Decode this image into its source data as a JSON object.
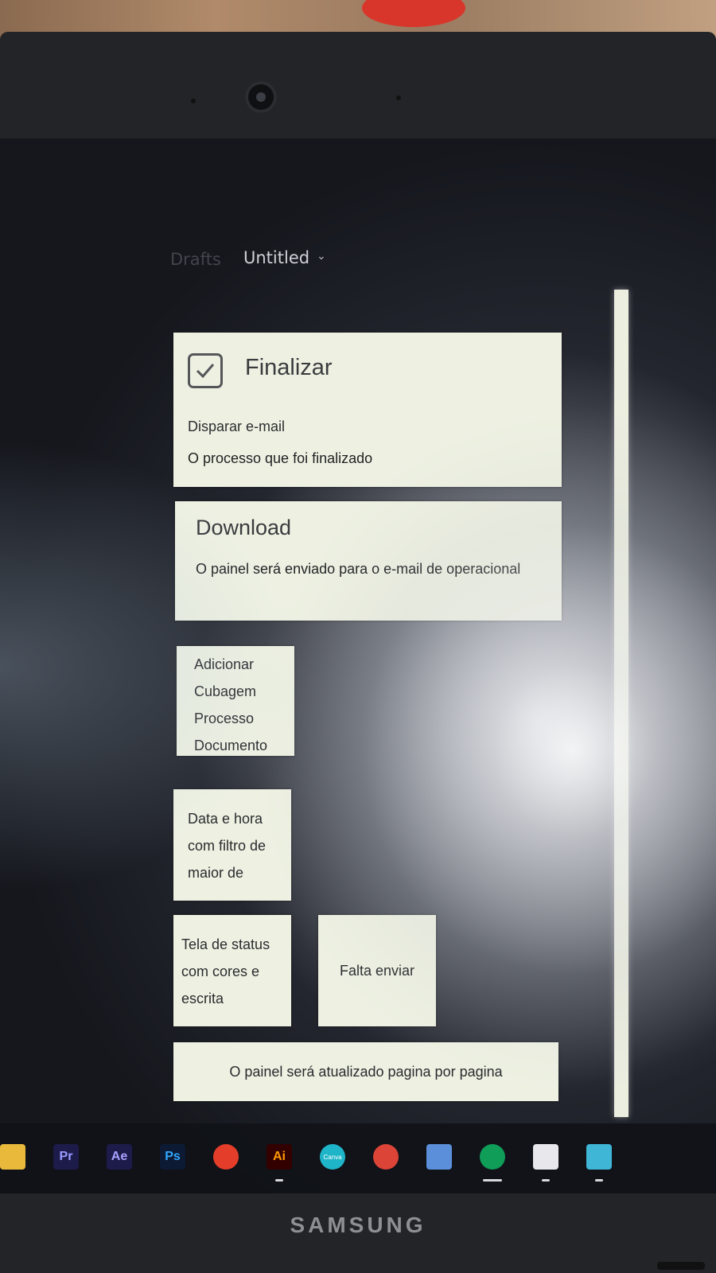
{
  "tabs": {
    "drafts": "Drafts",
    "current": "Untitled"
  },
  "cards": {
    "finalizar": {
      "title": "Finalizar",
      "line1": "Disparar e-mail",
      "line2": "O processo que foi finalizado"
    },
    "download": {
      "title": "Download",
      "body": "O painel será enviado para o e-mail de operacional"
    },
    "adicionar": [
      "Adicionar",
      "Cubagem",
      "Processo",
      "Documento"
    ],
    "data_hora": [
      "Data e hora",
      "com filtro de",
      "maior de"
    ],
    "tela_status": [
      "Tela de status",
      "com cores e",
      "escrita"
    ],
    "falta_enviar": "Falta enviar",
    "painel_atualizado": "O painel será atualizado pagina por pagina"
  },
  "taskbar": {
    "icons": [
      {
        "name": "folder-icon",
        "label": "",
        "bg": "#e8b93a",
        "fg": "#ffffff"
      },
      {
        "name": "premiere-icon",
        "label": "Pr",
        "bg": "#1d1b4a",
        "fg": "#9a9bff"
      },
      {
        "name": "after-effects-icon",
        "label": "Ae",
        "bg": "#1d1b4a",
        "fg": "#a9a2ff"
      },
      {
        "name": "photoshop-icon",
        "label": "Ps",
        "bg": "#0c1a33",
        "fg": "#31a8ff"
      },
      {
        "name": "ccleaner-icon",
        "label": "",
        "bg": "#e43e2a",
        "fg": "#ffffff"
      },
      {
        "name": "illustrator-icon",
        "label": "Ai",
        "bg": "#330000",
        "fg": "#ff9a00"
      },
      {
        "name": "canva-icon",
        "label": "Canva",
        "bg": "#1fb5c9",
        "fg": "#ffffff"
      },
      {
        "name": "chrome-profile-icon",
        "label": "",
        "bg": "#db4437",
        "fg": "#ffffff"
      },
      {
        "name": "document-app-icon",
        "label": "",
        "bg": "#5b8fd9",
        "fg": "#ffffff"
      },
      {
        "name": "chrome-icon",
        "label": "",
        "bg": "#0f9d58",
        "fg": "#ffffff"
      },
      {
        "name": "snipping-tool-icon",
        "label": "",
        "bg": "#e8e8ec",
        "fg": "#c0392b"
      },
      {
        "name": "notepad-icon",
        "label": "",
        "bg": "#3fb6d6",
        "fg": "#ffffff"
      }
    ]
  },
  "laptop_brand": "SAMSUNG"
}
